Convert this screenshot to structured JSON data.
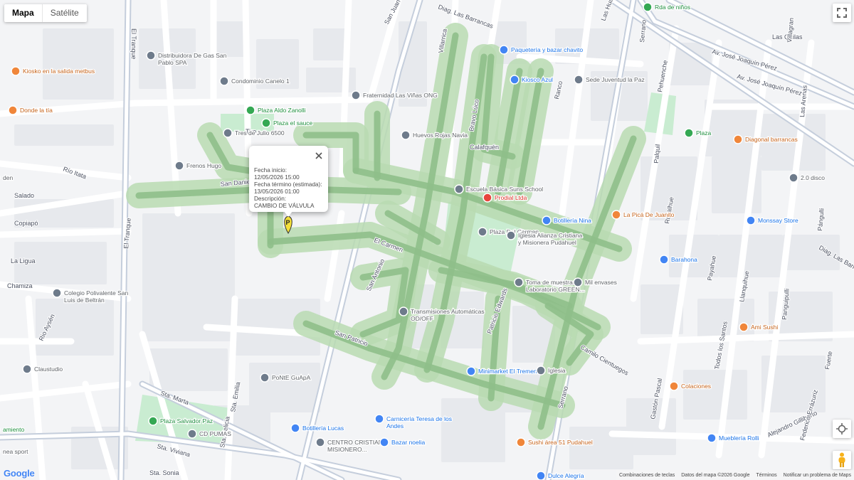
{
  "map_type": {
    "map_label": "Mapa",
    "satellite_label": "Satélite",
    "selected": "Mapa"
  },
  "info_window": {
    "start_label": "Fecha inicio:",
    "start_value": "12/05/2026 15:00",
    "end_label": "Fecha término (estimada):",
    "end_value": "13/05/2026 01:00",
    "desc_label": "Descripción:",
    "desc_value": "CAMBIO DE VÁLVULA"
  },
  "marker": {
    "letter": "P",
    "color": "#f4e03a"
  },
  "colors": {
    "affected_area": "#b8dbb2",
    "affected_street": "#8fbf8a",
    "park": "#c9ecd1",
    "road": "#ffffff",
    "major_road": "#c5cedc",
    "block": "#e7e9ed"
  },
  "street_labels": [
    "El Tranque",
    "Diag. Las Barrancas",
    "San Juan Valdés",
    "Villarrica",
    "Bravo Lúco",
    "Ranco",
    "Av. José Joaquín Pérez",
    "Av. José Joaquín Pérez",
    "Serrano",
    "Las Quilas",
    "Villagran",
    "San Daniel",
    "Río Itata",
    "Salado",
    "Copiapó",
    "La Ligua",
    "Camilo Cientuegos",
    "El Carmen",
    "San Antonio",
    "San Patricio",
    "Patricio Edwards",
    "Sta. Marta",
    "Sta. Viviana",
    "Sta. Emilia",
    "Sta. Felicia",
    "Sta. Sonia",
    "Gastón Pascal",
    "Alejandro Gilliberto",
    "Federico Errázuriz",
    "Diag. Las Barrancas",
    "Rucalhue",
    "Palquil",
    "Payahue",
    "Llanquihue",
    "Las Arenas",
    "Pángulli",
    "Panguipulli",
    "Todos los Santos",
    "Chamiza",
    "Rio Aysén",
    "Tiro",
    "Calafquén",
    "Serrano",
    "Pehuenche",
    "Las Hualtatas",
    "Fuerte",
    "El Tranque"
  ],
  "pois": [
    {
      "icon": "park-icon",
      "label": "Rda de niños"
    },
    {
      "icon": "store-icon",
      "label": "Paquetería y bazar chavito"
    },
    {
      "icon": "store-icon",
      "label": "Kiosco Azul"
    },
    {
      "icon": "place-icon",
      "label": "Sede Juventud la Paz"
    },
    {
      "icon": "place-icon",
      "label": "Distribuidora De Gas San Pablo SPA"
    },
    {
      "icon": "place-icon",
      "label": "Condominio Canelo 1"
    },
    {
      "icon": "place-icon",
      "label": "Fraternidad Las Viñas ONG"
    },
    {
      "icon": "restaurant-icon",
      "label": "Kiosko en la salida metbus"
    },
    {
      "icon": "restaurant-icon",
      "label": "Donde la tía"
    },
    {
      "icon": "park-icon",
      "label": "Plaza Aldo Zanolli"
    },
    {
      "icon": "park-icon",
      "label": "Plaza el sauce"
    },
    {
      "icon": "place-icon",
      "label": "Tres de Julio 6500"
    },
    {
      "icon": "place-icon",
      "label": "Huevos Rojas Navia"
    },
    {
      "icon": "place-icon",
      "label": "Frenos Hugo"
    },
    {
      "icon": "place-icon",
      "label": "Escuela Básica Suns School"
    },
    {
      "icon": "hospital-icon",
      "label": "Prodial Ltda"
    },
    {
      "icon": "store-icon",
      "label": "Botillería Nina"
    },
    {
      "icon": "restaurant-icon",
      "label": "La Picá De Juanito"
    },
    {
      "icon": "park-icon",
      "label": "Plaza"
    },
    {
      "icon": "restaurant-icon",
      "label": "Diagonal barrancas"
    },
    {
      "icon": "place-icon",
      "label": "2.0 disco"
    },
    {
      "icon": "store-icon",
      "label": "Monssay Store"
    },
    {
      "icon": "place-icon",
      "label": "Plaza Del Carmen"
    },
    {
      "icon": "church-icon",
      "label": "Iglesia Alianza Cristiana y Misionera Pudahuel"
    },
    {
      "icon": "store-icon",
      "label": "Barahona"
    },
    {
      "icon": "place-icon",
      "label": "Toma de muestras Laboratorio GREEN..."
    },
    {
      "icon": "place-icon",
      "label": "Mil envases"
    },
    {
      "icon": "place-icon",
      "label": "Colegio Polivalente San Luis de Beltrán"
    },
    {
      "icon": "place-icon",
      "label": "Transmisiones Automáticas OD/OFF"
    },
    {
      "icon": "restaurant-icon",
      "label": "Ami Sushi"
    },
    {
      "icon": "place-icon",
      "label": "Claustudio"
    },
    {
      "icon": "place-icon",
      "label": "PoNtE GuApA"
    },
    {
      "icon": "store-icon",
      "label": "Minimarket El Tremendo"
    },
    {
      "icon": "church-icon",
      "label": "Iglesia"
    },
    {
      "icon": "restaurant-icon",
      "label": "Colaciones"
    },
    {
      "icon": "park-icon",
      "label": "Plaza Salvador Paz"
    },
    {
      "icon": "place-icon",
      "label": "CD PUMAS"
    },
    {
      "icon": "store-icon",
      "label": "Botillería Lucas"
    },
    {
      "icon": "store-icon",
      "label": "Carnicería Teresa de los Andes"
    },
    {
      "icon": "place-icon",
      "label": "CENTRO CRISTIANO MISIONERO..."
    },
    {
      "icon": "store-icon",
      "label": "Bazar noelia"
    },
    {
      "icon": "store-icon",
      "label": "Mueblería Rolli"
    },
    {
      "icon": "restaurant-icon",
      "label": "Sushi área 51 Pudahuel"
    },
    {
      "icon": "store-icon",
      "label": "Dulce Alegría"
    },
    {
      "icon": "park-icon",
      "label": "amiento"
    },
    {
      "icon": "place-icon",
      "label": "nea sport"
    },
    {
      "icon": "place-icon",
      "label": "den"
    }
  ],
  "footer": {
    "shortcuts": "Combinaciones de teclas",
    "map_data": "Datos del mapa ©2026 Google",
    "terms": "Términos",
    "report": "Notificar un problema de Maps"
  },
  "logo_text": "Google"
}
